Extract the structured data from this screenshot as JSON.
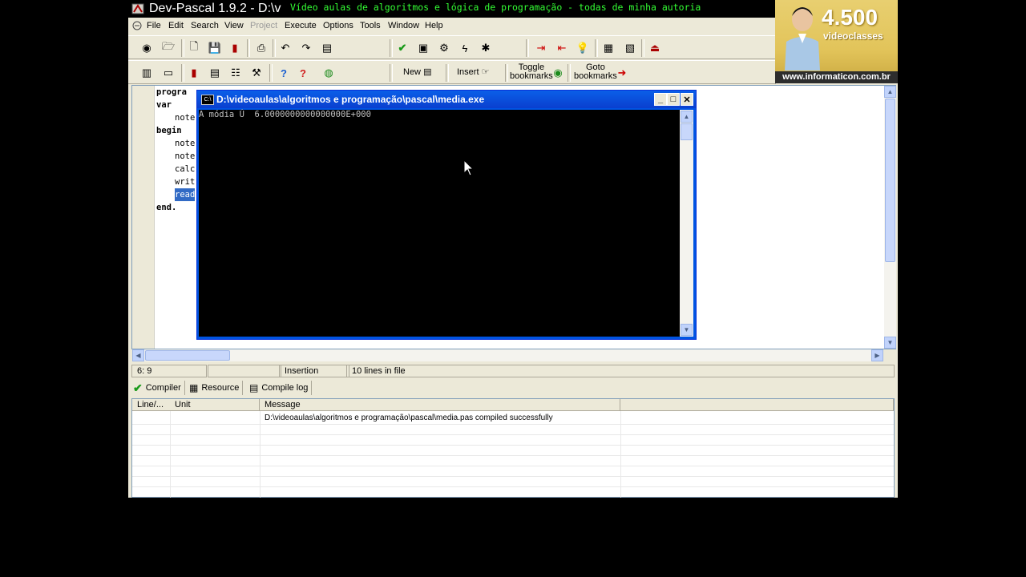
{
  "window": {
    "title": "Dev-Pascal 1.9.2 - D:\\v"
  },
  "banner": {
    "text": "Vídeo aulas de algoritmos e lógica de programação - todas de minha autoria"
  },
  "menu": [
    "File",
    "Edit",
    "Search",
    "View",
    "Project",
    "Execute",
    "Options",
    "Tools",
    "Window",
    "Help"
  ],
  "toolbar": {
    "new_label": "New",
    "insert_label": "Insert",
    "toggle_bookmarks_label": "Toggle\nbookmarks",
    "goto_bookmarks_label": "Goto\nbookmarks"
  },
  "ad": {
    "number": "4.500",
    "subtitle": "videoclasses",
    "url": "www.informaticon.com.br"
  },
  "editor": {
    "lines": [
      "progra",
      "var",
      "note",
      "begin",
      "note",
      "note",
      "calc",
      "writ",
      "read",
      "end."
    ]
  },
  "console": {
    "title": "D:\\videoaulas\\algoritmos e programação\\pascal\\media.exe",
    "output": "A módia Ú  6.0000000000000000E+000"
  },
  "status": {
    "position": "6: 9",
    "mode": "Insertion",
    "lines": "10 lines in file"
  },
  "tabs": [
    "Compiler",
    "Resource",
    "Compile log"
  ],
  "messages": {
    "headers": [
      "Line/...",
      "Unit",
      "Message"
    ],
    "rows": [
      {
        "line": "",
        "unit": "",
        "message": "D:\\videoaulas\\algoritmos e programação\\pascal\\media.pas compiled successfully"
      }
    ]
  },
  "colors": {
    "xp_blue": "#0054e3",
    "console_bg": "#000000",
    "selection": "#316ac5",
    "banner_green": "#34ff34"
  }
}
